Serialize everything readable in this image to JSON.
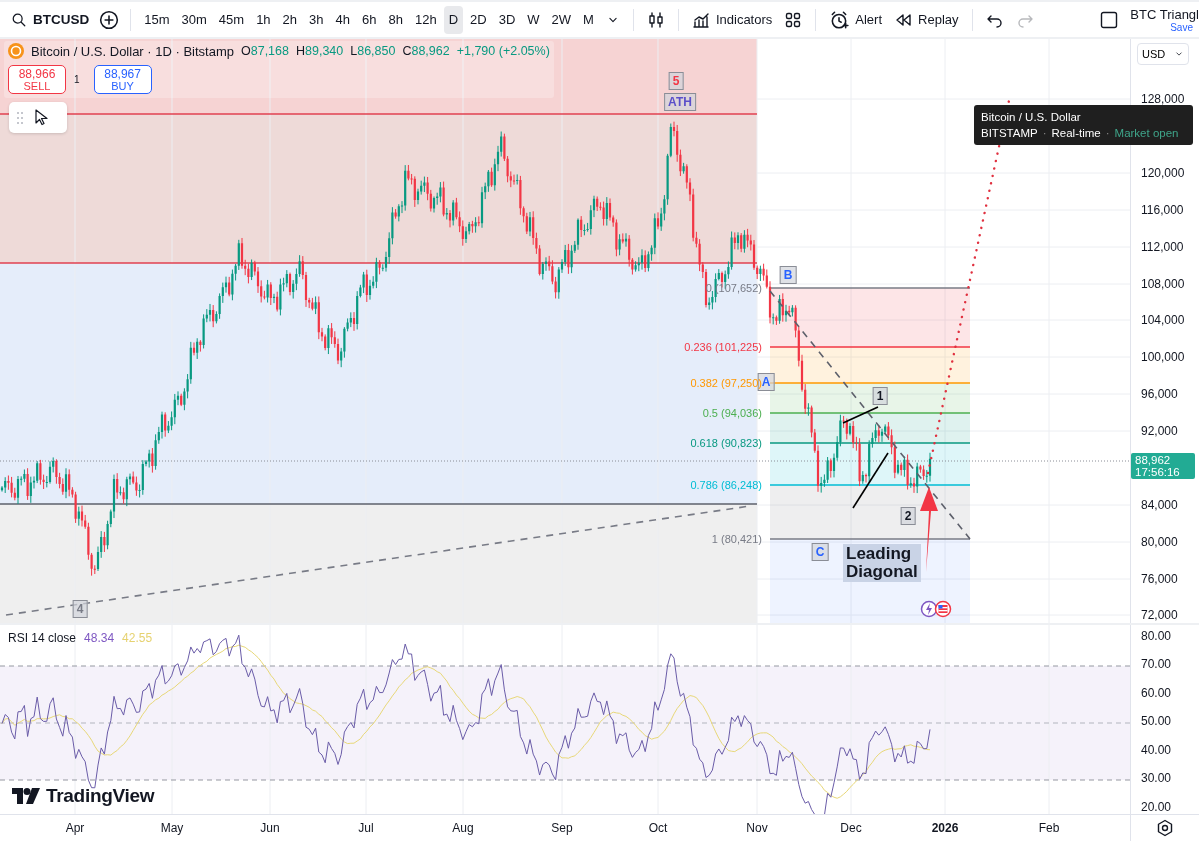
{
  "toolbar": {
    "symbol": "BTCUSD",
    "intervals": [
      {
        "label": "15m",
        "selected": false
      },
      {
        "label": "30m",
        "selected": false
      },
      {
        "label": "45m",
        "selected": false
      },
      {
        "label": "1h",
        "selected": false
      },
      {
        "label": "2h",
        "selected": false
      },
      {
        "label": "3h",
        "selected": false
      },
      {
        "label": "4h",
        "selected": false
      },
      {
        "label": "6h",
        "selected": false
      },
      {
        "label": "8h",
        "selected": false
      },
      {
        "label": "12h",
        "selected": false
      },
      {
        "label": "D",
        "selected": true
      },
      {
        "label": "2D",
        "selected": false
      },
      {
        "label": "3D",
        "selected": false
      },
      {
        "label": "W",
        "selected": false
      },
      {
        "label": "2W",
        "selected": false
      },
      {
        "label": "M",
        "selected": false
      }
    ],
    "indicators": "Indicators",
    "alert": "Alert",
    "replay": "Replay",
    "history": [
      {
        "kind": "undo",
        "disabled": false
      },
      {
        "kind": "redo",
        "disabled": true
      }
    ],
    "layout_checked": false,
    "layout_name": "BTC Triangl",
    "save": "Save"
  },
  "legend": {
    "title": "Bitcoin / U.S. Dollar · 1D · Bitstamp",
    "ohlc": [
      {
        "key": "O",
        "value": "87,168"
      },
      {
        "key": "H",
        "value": "89,340"
      },
      {
        "key": "L",
        "value": "86,850"
      },
      {
        "key": "C",
        "value": "88,962"
      }
    ],
    "change": "+1,790 (+2.05%)",
    "sell": {
      "price": "88,966",
      "label": "SELL"
    },
    "quantity": "1",
    "buy": {
      "price": "88,967",
      "label": "BUY"
    }
  },
  "chart": {
    "currency": "USD",
    "price_axis": [
      "128,000",
      "120,000",
      "116,000",
      "112,000",
      "108,000",
      "104,000",
      "100,000",
      "96,000",
      "92,000",
      "84,000",
      "80,000",
      "76,000",
      "72,000"
    ],
    "last_price": "88,962",
    "countdown": "17:56:16",
    "fib_levels": [
      {
        "label": "0 (107,652)",
        "color": "#787b86"
      },
      {
        "label": "0.236 (101,225)",
        "color": "#f23645"
      },
      {
        "label": "0.382 (97,250)",
        "color": "#ff9800"
      },
      {
        "label": "0.5 (94,036)",
        "color": "#4caf50"
      },
      {
        "label": "0.618 (90,823)",
        "color": "#089981"
      },
      {
        "label": "0.786 (86,248)",
        "color": "#00bcd4"
      },
      {
        "label": "1 (80,421)",
        "color": "#787b86"
      }
    ],
    "wave_labels": [
      {
        "text": "5",
        "color": "#f23645"
      },
      {
        "text": "ATH",
        "color": "#5b4fc9"
      },
      {
        "text": "B",
        "color": "#2962ff"
      },
      {
        "text": "A",
        "color": "#2962ff"
      },
      {
        "text": "1",
        "color": "#131722"
      },
      {
        "text": "2",
        "color": "#131722"
      },
      {
        "text": "C",
        "color": "#2962ff"
      },
      {
        "text": "4",
        "color": "#787b86"
      }
    ],
    "annotation": [
      "Leading",
      "Diagonal"
    ],
    "tooltip": {
      "title": "Bitcoin / U.S. Dollar",
      "separator": "·",
      "parts": [
        "BITSTAMP",
        "Real-time",
        "Market open"
      ]
    }
  },
  "rsi": {
    "title": "RSI 14 close",
    "value": "48.34",
    "ma_value": "42.55",
    "axis": [
      "80.00",
      "70.00",
      "60.00",
      "50.00",
      "40.00",
      "30.00",
      "20.00"
    ],
    "brand": "TradingView"
  },
  "time_axis": [
    {
      "label": "Apr",
      "kind": "month"
    },
    {
      "label": "May",
      "kind": "month"
    },
    {
      "label": "Jun",
      "kind": "month"
    },
    {
      "label": "Jul",
      "kind": "month"
    },
    {
      "label": "Aug",
      "kind": "month"
    },
    {
      "label": "Sep",
      "kind": "month"
    },
    {
      "label": "Oct",
      "kind": "month"
    },
    {
      "label": "Nov",
      "kind": "month"
    },
    {
      "label": "Dec",
      "kind": "month"
    },
    {
      "label": "2026",
      "kind": "year"
    },
    {
      "label": "Feb",
      "kind": "month"
    }
  ]
}
